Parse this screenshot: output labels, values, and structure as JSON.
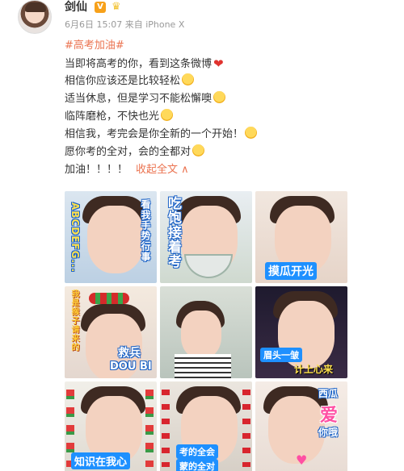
{
  "user": {
    "name": "剑仙",
    "badge": "V"
  },
  "meta": {
    "date": "6月6日 15:07",
    "from": "来自 iPhone X"
  },
  "post": {
    "topic": "#高考加油#",
    "lines": [
      "当即将高考的你，看到这条微博",
      "相信你应该还是比较轻松",
      "适当休息，但是学习不能松懈噢",
      "临阵磨枪，不快也光",
      "相信我，考完会是你全新的一个开始！",
      "愿你考的全对，会的全都对",
      "加油！！！！"
    ],
    "expand": "收起全文 ∧"
  },
  "grid": {
    "tiles": [
      {
        "caption_left": "ABCDEFG...",
        "caption_right": "看我手势行事"
      },
      {
        "caption_left": "吃饱接着考"
      },
      {
        "caption": "摸瓜开光"
      },
      {
        "caption_top": "我是猴子请来的",
        "caption": "救兵",
        "caption2": "DOU BI"
      },
      {},
      {
        "caption": "眉头一皱",
        "caption2": "计上心来"
      },
      {
        "caption": "知识在我心"
      },
      {
        "caption": "考的全会",
        "caption2": "蒙的全对"
      },
      {
        "caption_top": "西瓜",
        "caption": "爱",
        "caption2": "你哦"
      }
    ]
  },
  "colors": {
    "accent": "#eb7350",
    "caption_blue": "#1e90ff"
  }
}
